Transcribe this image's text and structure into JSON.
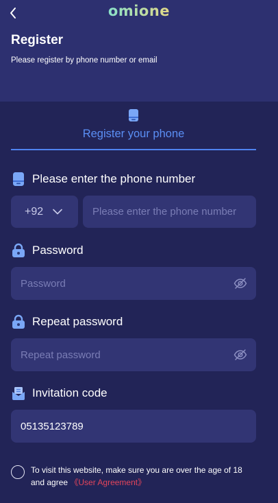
{
  "header": {
    "logo_text": "omione",
    "title": "Register",
    "subtitle": "Please register by phone number or email"
  },
  "tab": {
    "label": "Register your phone",
    "active_color": "#5b8ff5"
  },
  "phone": {
    "label": "Please enter the phone number",
    "country_code": "+92",
    "placeholder": "Please enter the phone number"
  },
  "password": {
    "label": "Password",
    "placeholder": "Password"
  },
  "repeat_password": {
    "label": "Repeat password",
    "placeholder": "Repeat password"
  },
  "invitation": {
    "label": "Invitation code",
    "value": "05135123789"
  },
  "agreement": {
    "text": "To visit this website, make sure you are over the age of 18 and agree",
    "link": "《User Agreement》"
  },
  "icons": {
    "back": "chevron-left-icon",
    "phone": "phone-icon",
    "lock": "lock-icon",
    "eye": "eye-off-icon",
    "invite": "invitation-icon",
    "dropdown": "chevron-down-icon"
  },
  "colors": {
    "background": "#222457",
    "header": "#2d3070",
    "input": "#323574",
    "accent": "#5b8ff5",
    "link": "#e4455b"
  }
}
